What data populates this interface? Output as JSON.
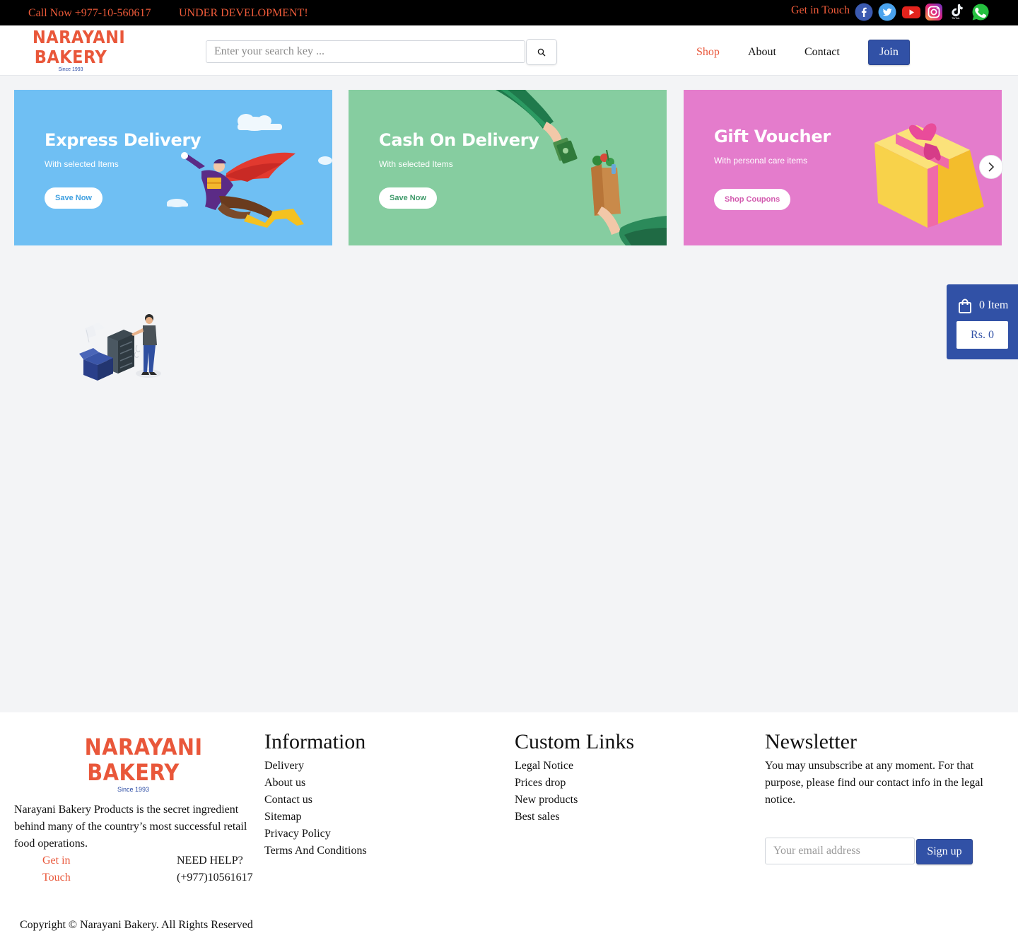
{
  "topbar": {
    "call": "Call Now +977-10-560617",
    "notice": "UNDER DEVELOPMENT!",
    "get_in_touch": "Get in Touch",
    "social_icons": [
      "facebook-icon",
      "twitter-icon",
      "youtube-icon",
      "instagram-icon",
      "tiktok-icon",
      "whatsapp-icon"
    ],
    "tiktok_caption": "TikTok"
  },
  "brand": {
    "line1": "NARAYANI",
    "line2": "BAKERY",
    "tagline": "Since 1993",
    "color": "#e9573a",
    "accent": "#3151a6"
  },
  "search": {
    "placeholder": "Enter your search key ...",
    "value": "",
    "button_icon": "search-icon"
  },
  "nav": {
    "items": [
      "Shop",
      "About",
      "Contact"
    ],
    "active": "Shop",
    "join_label": "Join"
  },
  "banners": [
    {
      "title": "Express Delivery",
      "subtitle": "With selected Items",
      "button": "Save Now",
      "bg": "#6fbff3"
    },
    {
      "title": "Cash On Delivery",
      "subtitle": "With selected Items",
      "button": "Save Now",
      "bg": "#86cda0"
    },
    {
      "title": "Gift Voucher",
      "subtitle": "With personal care items",
      "button": "Shop Coupons",
      "bg": "#e47ccc"
    }
  ],
  "cart": {
    "count_label": "0 Item",
    "total_label": "Rs. 0"
  },
  "footer": {
    "about": "Narayani Bakery Products is the secret ingredient behind many of the country’s most successful retail food operations.",
    "get_in_touch": "Get in Touch",
    "need_help": "NEED HELP?",
    "phone": "(+977)10561617",
    "information": {
      "heading": "Information",
      "links": [
        "Delivery",
        "About us",
        "Contact us",
        "Sitemap",
        "Privacy Policy",
        "Terms And Conditions"
      ]
    },
    "custom_links": {
      "heading": "Custom Links",
      "links": [
        "Legal Notice",
        "Prices drop",
        "New products",
        "Best sales"
      ]
    },
    "newsletter": {
      "heading": "Newsletter",
      "text": "You may unsubscribe at any moment. For that purpose, please find our contact info in the legal notice.",
      "placeholder": "Your email address",
      "button": "Sign up"
    },
    "copyright": "Copyright © Narayani Bakery. All Rights Reserved"
  }
}
